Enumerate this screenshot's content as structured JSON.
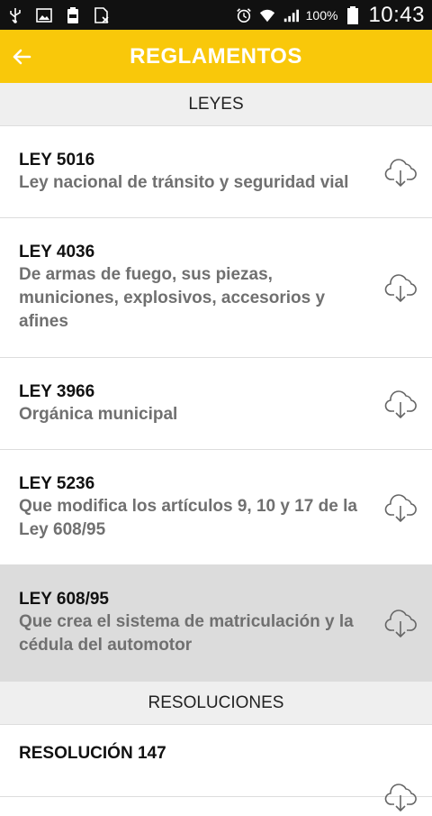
{
  "status_bar": {
    "battery": "100%",
    "time": "10:43"
  },
  "header": {
    "title": "REGLAMENTOS"
  },
  "sections": [
    {
      "title": "LEYES",
      "items": [
        {
          "code": "LEY 5016",
          "description": "Ley nacional de tránsito y seguridad vial"
        },
        {
          "code": "LEY 4036",
          "description": "De armas de fuego, sus piezas, municiones, explosivos, accesorios y afines"
        },
        {
          "code": "LEY 3966",
          "description": "Orgánica municipal"
        },
        {
          "code": "LEY 5236",
          "description": "Que modifica los artículos 9, 10 y 17 de la Ley 608/95"
        },
        {
          "code": "LEY 608/95",
          "description": "Que crea el sistema de matriculación y la cédula del automotor"
        }
      ]
    },
    {
      "title": "RESOLUCIONES",
      "items": [
        {
          "code": "RESOLUCIÓN 147"
        }
      ]
    }
  ],
  "colors": {
    "appbar": "#F9C80A",
    "section_bg": "#EFEFEF",
    "highlight_bg": "#DCDCDC"
  },
  "icons": {
    "back": "arrow-left-icon",
    "download": "cloud-download-icon"
  }
}
